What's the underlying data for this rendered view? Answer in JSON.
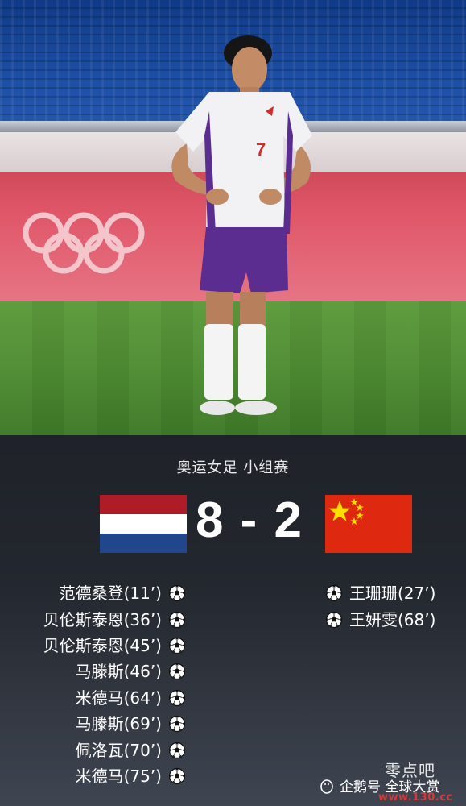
{
  "match": {
    "competition": "奥运女足 小组赛",
    "home_team_flag": "netherlands-flag",
    "away_team_flag": "china-flag",
    "score": "8 - 2"
  },
  "home_scorers": [
    {
      "text": "范德桑登(11’)",
      "icon": "soccer-ball-icon"
    },
    {
      "text": "贝伦斯泰恩(36’)",
      "icon": "soccer-ball-icon"
    },
    {
      "text": "贝伦斯泰恩(45’)",
      "icon": "soccer-ball-icon"
    },
    {
      "text": "马滕斯(46’)",
      "icon": "soccer-ball-icon"
    },
    {
      "text": "米德马(64’)",
      "icon": "soccer-ball-icon"
    },
    {
      "text": "马滕斯(69’)",
      "icon": "soccer-ball-icon"
    },
    {
      "text": "佩洛瓦(70’)",
      "icon": "soccer-ball-icon"
    },
    {
      "text": "米德马(75’)",
      "icon": "soccer-ball-icon"
    }
  ],
  "away_scorers": [
    {
      "text": "王珊珊(27’)",
      "icon": "soccer-ball-icon"
    },
    {
      "text": "王妍雯(68’)",
      "icon": "soccer-ball-icon"
    }
  ],
  "photo": {
    "jersey_number": "7"
  },
  "watermark": {
    "label": "企鹅号 全球大赏",
    "site_name": "零点吧",
    "site_url": "www.130.cc"
  },
  "colors": {
    "panel_background": "#23272e",
    "nl_red": "#ae1c28",
    "nl_white": "#ffffff",
    "nl_blue": "#21468b",
    "cn_red": "#de2910",
    "cn_yellow": "#ffde00"
  }
}
